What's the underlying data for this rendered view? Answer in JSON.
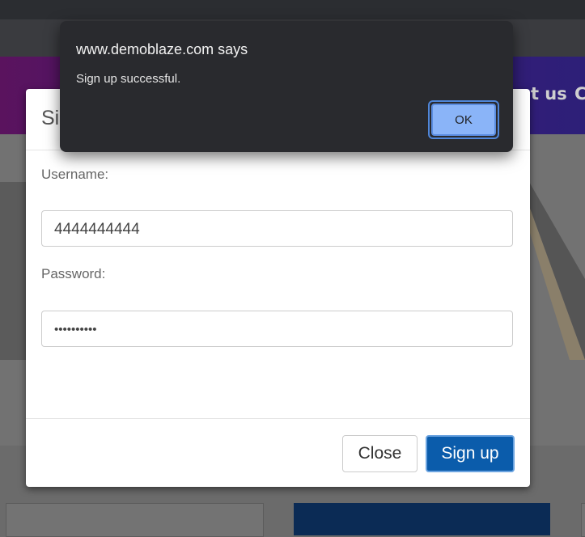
{
  "alert": {
    "origin": "www.demoblaze.com says",
    "message": "Sign up successful.",
    "ok_label": "OK"
  },
  "modal": {
    "title": "Sig",
    "close_glyph": "×",
    "username_label": "Username:",
    "username_value": "4444444444",
    "password_label": "Password:",
    "password_value": "••••••••••",
    "close_button": "Close",
    "signup_button": "Sign up"
  },
  "background": {
    "nav_link_1": "ut us",
    "nav_link_2": "C"
  },
  "colors": {
    "primary_button": "#0b5cab",
    "alert_bg": "#292a2e",
    "alert_ok": "#8ab4f8",
    "navbar": "#3b1b77"
  }
}
